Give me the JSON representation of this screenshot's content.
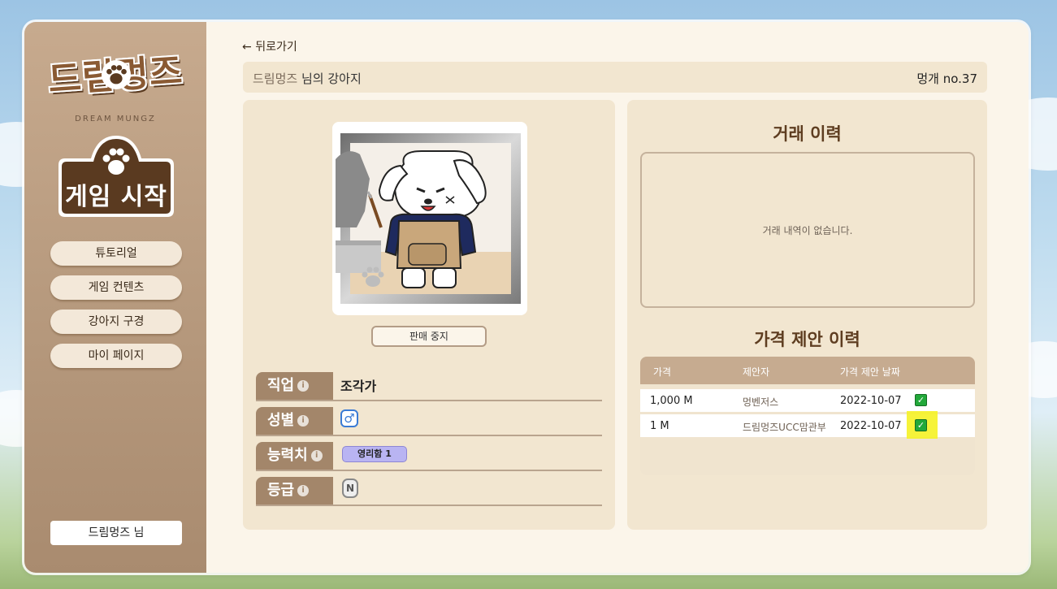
{
  "sidebar": {
    "logo_text": "드림멍즈",
    "logo_subtitle": "DREAM MUNGZ",
    "start_label": "게임 시작",
    "nav": [
      "튜토리얼",
      "게임 컨텐츠",
      "강아지 구경",
      "마이 페이지"
    ],
    "user_label": "드림멍즈 님"
  },
  "main": {
    "back_label": "뒤로가기",
    "owner_name": "드림멍즈",
    "owner_suffix": " 님의 강아지",
    "dog_number": "멍개 no.37",
    "stop_sale_label": "판매 중지",
    "attributes": [
      {
        "key": "직업",
        "value": "조각가"
      },
      {
        "key": "성별",
        "value": "♂"
      },
      {
        "key": "능력치",
        "value": "영리함 1"
      },
      {
        "key": "등급",
        "value": "N"
      }
    ]
  },
  "trade": {
    "history_title": "거래 이력",
    "empty_text": "거래 내역이 없습니다.",
    "offers_title": "가격 제안 이력",
    "columns": [
      "가격",
      "제안자",
      "가격 제안 날짜"
    ],
    "rows": [
      {
        "price": "1,000 M",
        "proposer": "멍벤저스",
        "date": "2022-10-07",
        "checked": true,
        "highlighted": false
      },
      {
        "price": "1 M",
        "proposer": "드림멍즈UCC맘관부",
        "date": "2022-10-07",
        "checked": true,
        "highlighted": true
      }
    ]
  },
  "colors": {
    "sidebar": "#b79a7e",
    "panel": "#f2e6d0",
    "accent_brown": "#a3866a",
    "title_brown": "#5e3d20",
    "check_green": "#22a83a",
    "highlight_yellow": "#f5f225"
  }
}
